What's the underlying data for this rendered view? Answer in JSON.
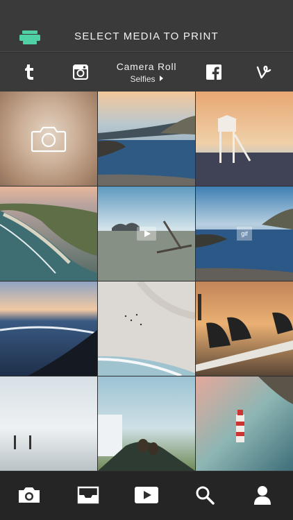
{
  "header": {
    "title": "SELECT MEDIA TO PRINT",
    "logo_icon": "printer-icon",
    "accent": "#4fd1a5"
  },
  "sources": {
    "items": [
      {
        "name": "tumblr",
        "icon": "tumblr-icon"
      },
      {
        "name": "instagram",
        "icon": "instagram-icon"
      },
      {
        "name": "facebook",
        "icon": "facebook-icon"
      },
      {
        "name": "vine",
        "icon": "vine-icon"
      }
    ],
    "album_source": "Camera Roll",
    "album_name": "Selfies"
  },
  "grid": {
    "items": [
      {
        "type": "camera",
        "icon": "camera-icon"
      },
      {
        "type": "photo",
        "scene": "lake at sunset"
      },
      {
        "type": "photo",
        "scene": "lifeguard tower"
      },
      {
        "type": "photo",
        "scene": "aerial coastline"
      },
      {
        "type": "video",
        "scene": "beach driftwood",
        "badge_icon": "play-icon"
      },
      {
        "type": "gif",
        "scene": "lake reflection",
        "badge_text": "gif"
      },
      {
        "type": "photo",
        "scene": "ocean sunset"
      },
      {
        "type": "photo",
        "scene": "sand aerial"
      },
      {
        "type": "photo",
        "scene": "surfboards"
      },
      {
        "type": "photo",
        "scene": "foggy beach"
      },
      {
        "type": "photo",
        "scene": "beach legs"
      },
      {
        "type": "photo",
        "scene": "lighthouse"
      }
    ]
  },
  "tabbar": {
    "items": [
      {
        "name": "camera",
        "icon": "camera-icon"
      },
      {
        "name": "inbox",
        "icon": "inbox-icon"
      },
      {
        "name": "video",
        "icon": "play-icon"
      },
      {
        "name": "search",
        "icon": "search-icon"
      },
      {
        "name": "profile",
        "icon": "user-icon"
      }
    ]
  }
}
